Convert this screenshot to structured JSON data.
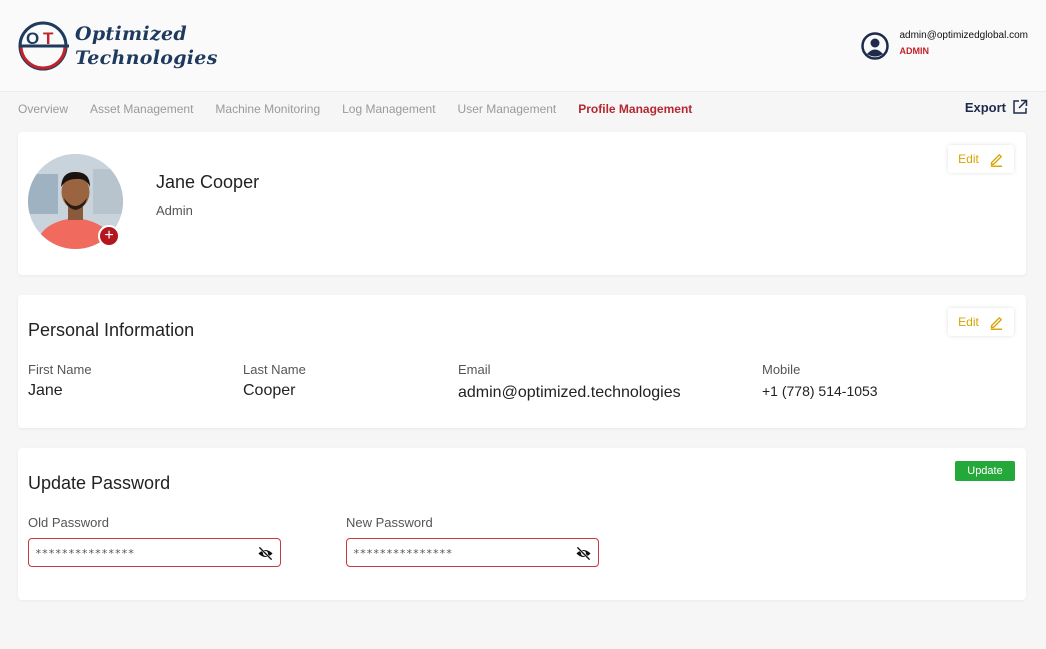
{
  "brand": {
    "line1": "Optimized",
    "line2": "Technologies",
    "mark_letters": "OT"
  },
  "user": {
    "email": "admin@optimizedglobal.com",
    "role": "ADMIN"
  },
  "nav": {
    "items": [
      {
        "label": "Overview",
        "active": false
      },
      {
        "label": "Asset Management",
        "active": false
      },
      {
        "label": "Machine Monitoring",
        "active": false
      },
      {
        "label": "Log Management",
        "active": false
      },
      {
        "label": "User Management",
        "active": false
      },
      {
        "label": "Profile Management",
        "active": true
      }
    ],
    "export_label": "Export"
  },
  "profile": {
    "name": "Jane Cooper",
    "role": "Admin",
    "edit_label": "Edit",
    "add_photo_symbol": "+"
  },
  "personal": {
    "title": "Personal Information",
    "edit_label": "Edit",
    "fields": [
      {
        "label": "First Name",
        "value": "Jane"
      },
      {
        "label": "Last Name",
        "value": "Cooper"
      },
      {
        "label": "Email",
        "value": "admin@optimized.technologies"
      },
      {
        "label": "Mobile",
        "value": "+1 (778) 514-1053"
      }
    ]
  },
  "password": {
    "title": "Update Password",
    "update_label": "Update",
    "old_label": "Old Password",
    "old_value": "***************",
    "new_label": "New Password",
    "new_value": "***************"
  },
  "colors": {
    "accent_red": "#b52832",
    "brand_navy": "#1f3a5f",
    "edit_gold": "#d8a300",
    "update_green": "#25a83a"
  },
  "icons": {
    "logo": "ot-logo-icon",
    "user": "user-circle-icon",
    "export": "external-link-icon",
    "edit": "pencil-icon",
    "eye": "eye-slash-icon",
    "add": "plus-icon"
  }
}
